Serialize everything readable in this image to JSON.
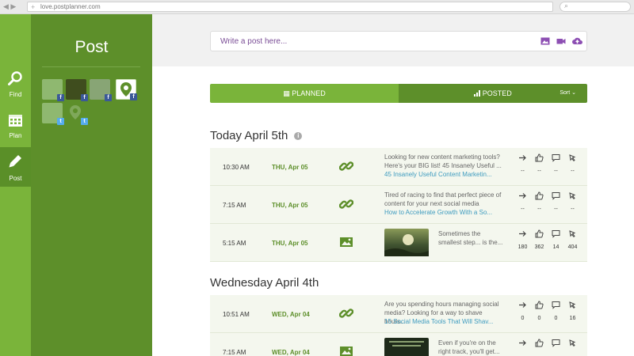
{
  "browser": {
    "url": "love.postplanner.com"
  },
  "rail": {
    "items": [
      {
        "label": "Find",
        "icon": "search-icon"
      },
      {
        "label": "Plan",
        "icon": "calendar-icon"
      },
      {
        "label": "Post",
        "icon": "pencil-icon"
      }
    ]
  },
  "sidebar": {
    "title": "Post"
  },
  "composer": {
    "placeholder": "Write a post here..."
  },
  "tabs": {
    "planned": "PLANNED",
    "posted": "POSTED",
    "sort": "Sort"
  },
  "days": [
    {
      "title": "Today April 5th",
      "posts": [
        {
          "time": "10:30 AM",
          "date": "THU, Apr 05",
          "type": "link",
          "text": "Looking for new content marketing tools? Here's your BIG list! 45 Insanely Useful ...",
          "link": "45 Insanely Useful Content Marketin...",
          "stats": [
            "--",
            "--",
            "--",
            "--"
          ]
        },
        {
          "time": "7:15 AM",
          "date": "THU, Apr 05",
          "type": "link",
          "text": "Tired of racing to find that perfect piece of content for your next social media",
          "link": "How to Accelerate Growth With a So...",
          "stats": [
            "--",
            "--",
            "--",
            "--"
          ]
        },
        {
          "time": "5:15 AM",
          "date": "THU, Apr 05",
          "type": "image",
          "text": "Sometimes the smallest step... is the...",
          "stats": [
            "180",
            "362",
            "14",
            "404"
          ]
        }
      ]
    },
    {
      "title": "Wednesday April 4th",
      "posts": [
        {
          "time": "10:51 AM",
          "date": "WED, Apr 04",
          "type": "link",
          "text": "Are you spending hours managing social media? Looking for a way to shave hours...",
          "link": "15 Social Media Tools That Will Shav...",
          "stats": [
            "0",
            "0",
            "0",
            "16"
          ]
        },
        {
          "time": "7:15 AM",
          "date": "WED, Apr 04",
          "type": "image",
          "text": "Even if you're on the right track, you'll get...",
          "stats": [
            "",
            "",
            "",
            ""
          ]
        }
      ]
    }
  ],
  "colors": {
    "green_light": "#7ab43a",
    "green_dark": "#5d8f2a",
    "purple": "#8d4fb3",
    "link_blue": "#3d9bbf"
  }
}
